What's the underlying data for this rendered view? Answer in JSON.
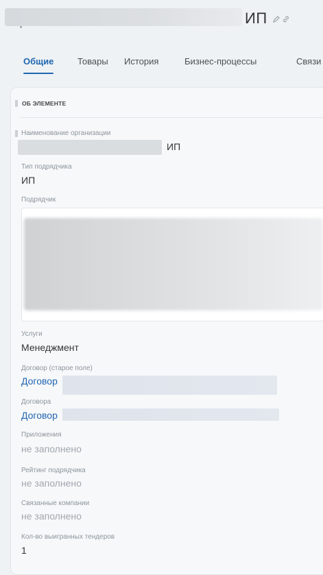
{
  "header": {
    "title_suffix": "ИП"
  },
  "tabs": [
    {
      "label": "Общие",
      "active": true
    },
    {
      "label": "Товары"
    },
    {
      "label": "История"
    },
    {
      "label": "Бизнес-процессы"
    },
    {
      "label": "Связи"
    }
  ],
  "section": {
    "title": "ОБ ЭЛЕМЕНТЕ"
  },
  "fields": {
    "org_name": {
      "label": "Наименование организации",
      "value": "ИП"
    },
    "contractor_type": {
      "label": "Тип подрядчика",
      "value": "ИП"
    },
    "contractor": {
      "label": "Подрядчик"
    },
    "services": {
      "label": "Услуги",
      "value": "Менеджмент"
    },
    "contract_old": {
      "label": "Договор (старое поле)",
      "value": "Договор"
    },
    "contracts": {
      "label": "Договора",
      "value": "Договор"
    },
    "attachments": {
      "label": "Приложения",
      "value": "не заполнено"
    },
    "rating": {
      "label": "Рейтинг подрядчика",
      "value": "не заполнено"
    },
    "related_companies": {
      "label": "Связанные компании",
      "value": "не заполнено"
    },
    "tenders_won": {
      "label": "Кол-во выигранных тендеров",
      "value": "1"
    }
  },
  "colors": {
    "accent": "#2066b0",
    "background": "#eef2f4"
  },
  "icons": [
    "pencil-icon",
    "link-icon",
    "drag-handle-icon"
  ]
}
